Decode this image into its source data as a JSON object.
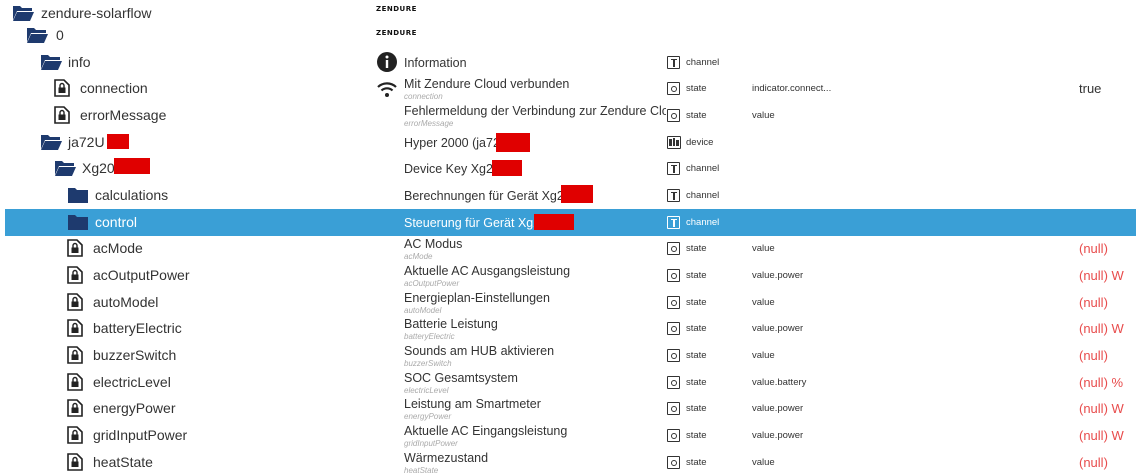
{
  "tree": {
    "rows": [
      {
        "label": "zendure-solarflow",
        "name": "",
        "role": "",
        "type": "",
        "value": "",
        "logo": "ZENDURE"
      },
      {
        "label": "0",
        "name": "",
        "role": "",
        "type": "",
        "value": "",
        "logo": "ZENDURE"
      },
      {
        "label": "info",
        "name": "Information",
        "sub": "",
        "role": "channel",
        "type": "",
        "value": ""
      },
      {
        "label": "connection",
        "name": "Mit Zendure Cloud verbunden",
        "sub": "connection",
        "role": "state",
        "type": "indicator.connect...",
        "value": "true"
      },
      {
        "label": "errorMessage",
        "name": "Fehlermeldung der Verbindung zur Zendure Cloud",
        "sub": "errorMessage",
        "role": "state",
        "type": "value",
        "value": ""
      },
      {
        "label": "ja72U",
        "name": "Hyper 2000 (ja72U",
        "sub": "",
        "role": "device",
        "type": "",
        "value": ""
      },
      {
        "label": "Xg20",
        "name": "Device Key Xg20",
        "sub": "",
        "role": "channel",
        "type": "",
        "value": ""
      },
      {
        "label": "calculations",
        "name": "Berechnungen für Gerät Xg202",
        "sub": "",
        "role": "channel",
        "type": "",
        "value": ""
      },
      {
        "label": "control",
        "name": "Steuerung für Gerät Xg20",
        "sub": "",
        "role": "channel",
        "type": "",
        "value": ""
      },
      {
        "label": "acMode",
        "name": "AC Modus",
        "sub": "acMode",
        "role": "state",
        "type": "value",
        "value": "(null)"
      },
      {
        "label": "acOutputPower",
        "name": "Aktuelle AC Ausgangsleistung",
        "sub": "acOutputPower",
        "role": "state",
        "type": "value.power",
        "value": "(null) W"
      },
      {
        "label": "autoModel",
        "name": "Energieplan-Einstellungen",
        "sub": "autoModel",
        "role": "state",
        "type": "value",
        "value": "(null)"
      },
      {
        "label": "batteryElectric",
        "name": "Batterie Leistung",
        "sub": "batteryElectric",
        "role": "state",
        "type": "value.power",
        "value": "(null) W"
      },
      {
        "label": "buzzerSwitch",
        "name": "Sounds am HUB aktivieren",
        "sub": "buzzerSwitch",
        "role": "state",
        "type": "value",
        "value": "(null)"
      },
      {
        "label": "electricLevel",
        "name": "SOC Gesamtsystem",
        "sub": "electricLevel",
        "role": "state",
        "type": "value.battery",
        "value": "(null) %"
      },
      {
        "label": "energyPower",
        "name": "Leistung am Smartmeter",
        "sub": "energyPower",
        "role": "state",
        "type": "value.power",
        "value": "(null) W"
      },
      {
        "label": "gridInputPower",
        "name": "Aktuelle AC Eingangsleistung",
        "sub": "gridInputPower",
        "role": "state",
        "type": "value.power",
        "value": "(null) W"
      },
      {
        "label": "heatState",
        "name": "Wärmezustand",
        "sub": "heatState",
        "role": "state",
        "type": "value",
        "value": "(null)"
      }
    ]
  },
  "colors": {
    "selected": "#3a9fd6",
    "folder": "#1e3a6e",
    "null_value": "#e84c4c"
  }
}
